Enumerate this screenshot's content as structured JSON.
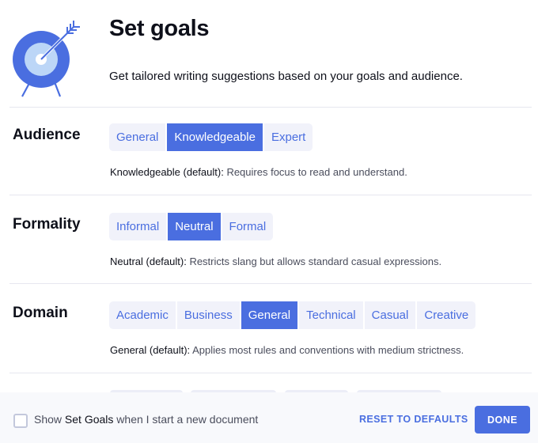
{
  "header": {
    "logo_icon": "target-arrow-icon",
    "title": "Set goals",
    "subtitle": "Get tailored writing suggestions based on your goals and audience."
  },
  "sections": [
    {
      "label": "Audience",
      "options": [
        "General",
        "Knowledgeable",
        "Expert"
      ],
      "selected": "Knowledgeable",
      "description_key": "Knowledgeable (default):",
      "description_text": " Requires focus to read and understand."
    },
    {
      "label": "Formality",
      "options": [
        "Informal",
        "Neutral",
        "Formal"
      ],
      "selected": "Neutral",
      "description_key": "Neutral (default):",
      "description_text": " Restricts slang but allows standard casual expressions."
    },
    {
      "label": "Domain",
      "options": [
        "Academic",
        "Business",
        "General",
        "Technical",
        "Casual",
        "Creative"
      ],
      "selected": "General",
      "description_key": "General (default):",
      "description_text": " Applies most rules and conventions with medium strictness."
    }
  ],
  "footer": {
    "checkbox_checked": false,
    "checkbox_label_pre": "Show ",
    "checkbox_label_strong": "Set Goals",
    "checkbox_label_post": " when I start a new document",
    "reset_label": "RESET TO DEFAULTS",
    "done_label": "DONE"
  },
  "colors": {
    "accent": "#4a6ee0",
    "segment_bg": "#f1f2fa",
    "logo_outer": "#4a6ee0",
    "logo_inner": "#bcd6f7",
    "footer_bg": "#f8f9fc",
    "divider": "#e6e7ef"
  }
}
